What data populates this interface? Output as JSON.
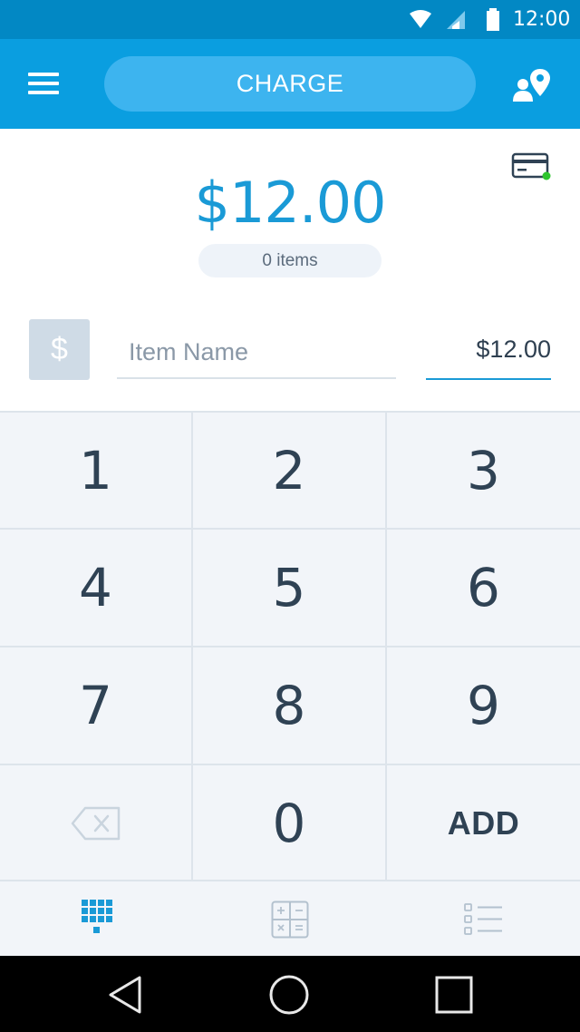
{
  "status_bar": {
    "time": "12:00",
    "icons": [
      "wifi-icon",
      "signal-icon",
      "battery-icon"
    ]
  },
  "app_bar": {
    "menu_icon": "hamburger-menu-icon",
    "charge_label": "CHARGE",
    "location_icon": "customer-location-icon"
  },
  "amount_panel": {
    "card_reader_icon": "card-reader-connected-icon",
    "total": "$12.00",
    "items_count": "0 items"
  },
  "entry": {
    "dollar_tile": "$",
    "item_name_placeholder": "Item Name",
    "item_name_value": "",
    "price": "$12.00"
  },
  "keypad": {
    "keys": [
      "1",
      "2",
      "3",
      "4",
      "5",
      "6",
      "7",
      "8",
      "9",
      "backspace",
      "0",
      "ADD"
    ]
  },
  "tabs": [
    {
      "name": "keypad-tab",
      "icon": "keypad-icon",
      "active": true
    },
    {
      "name": "calculator-tab",
      "icon": "calculator-icon",
      "active": false
    },
    {
      "name": "item-list-tab",
      "icon": "list-icon",
      "active": false
    }
  ],
  "nav_bar": {
    "buttons": [
      "back-icon",
      "home-icon",
      "recents-icon"
    ]
  },
  "colors": {
    "status_bar": "#0288c4",
    "app_bar": "#0a9ee0",
    "charge_button": "#3db4ef",
    "accent": "#1a9ad6",
    "keypad_bg": "#f2f5f9",
    "key_text": "#2f4254",
    "online_dot": "#2ec52e"
  }
}
